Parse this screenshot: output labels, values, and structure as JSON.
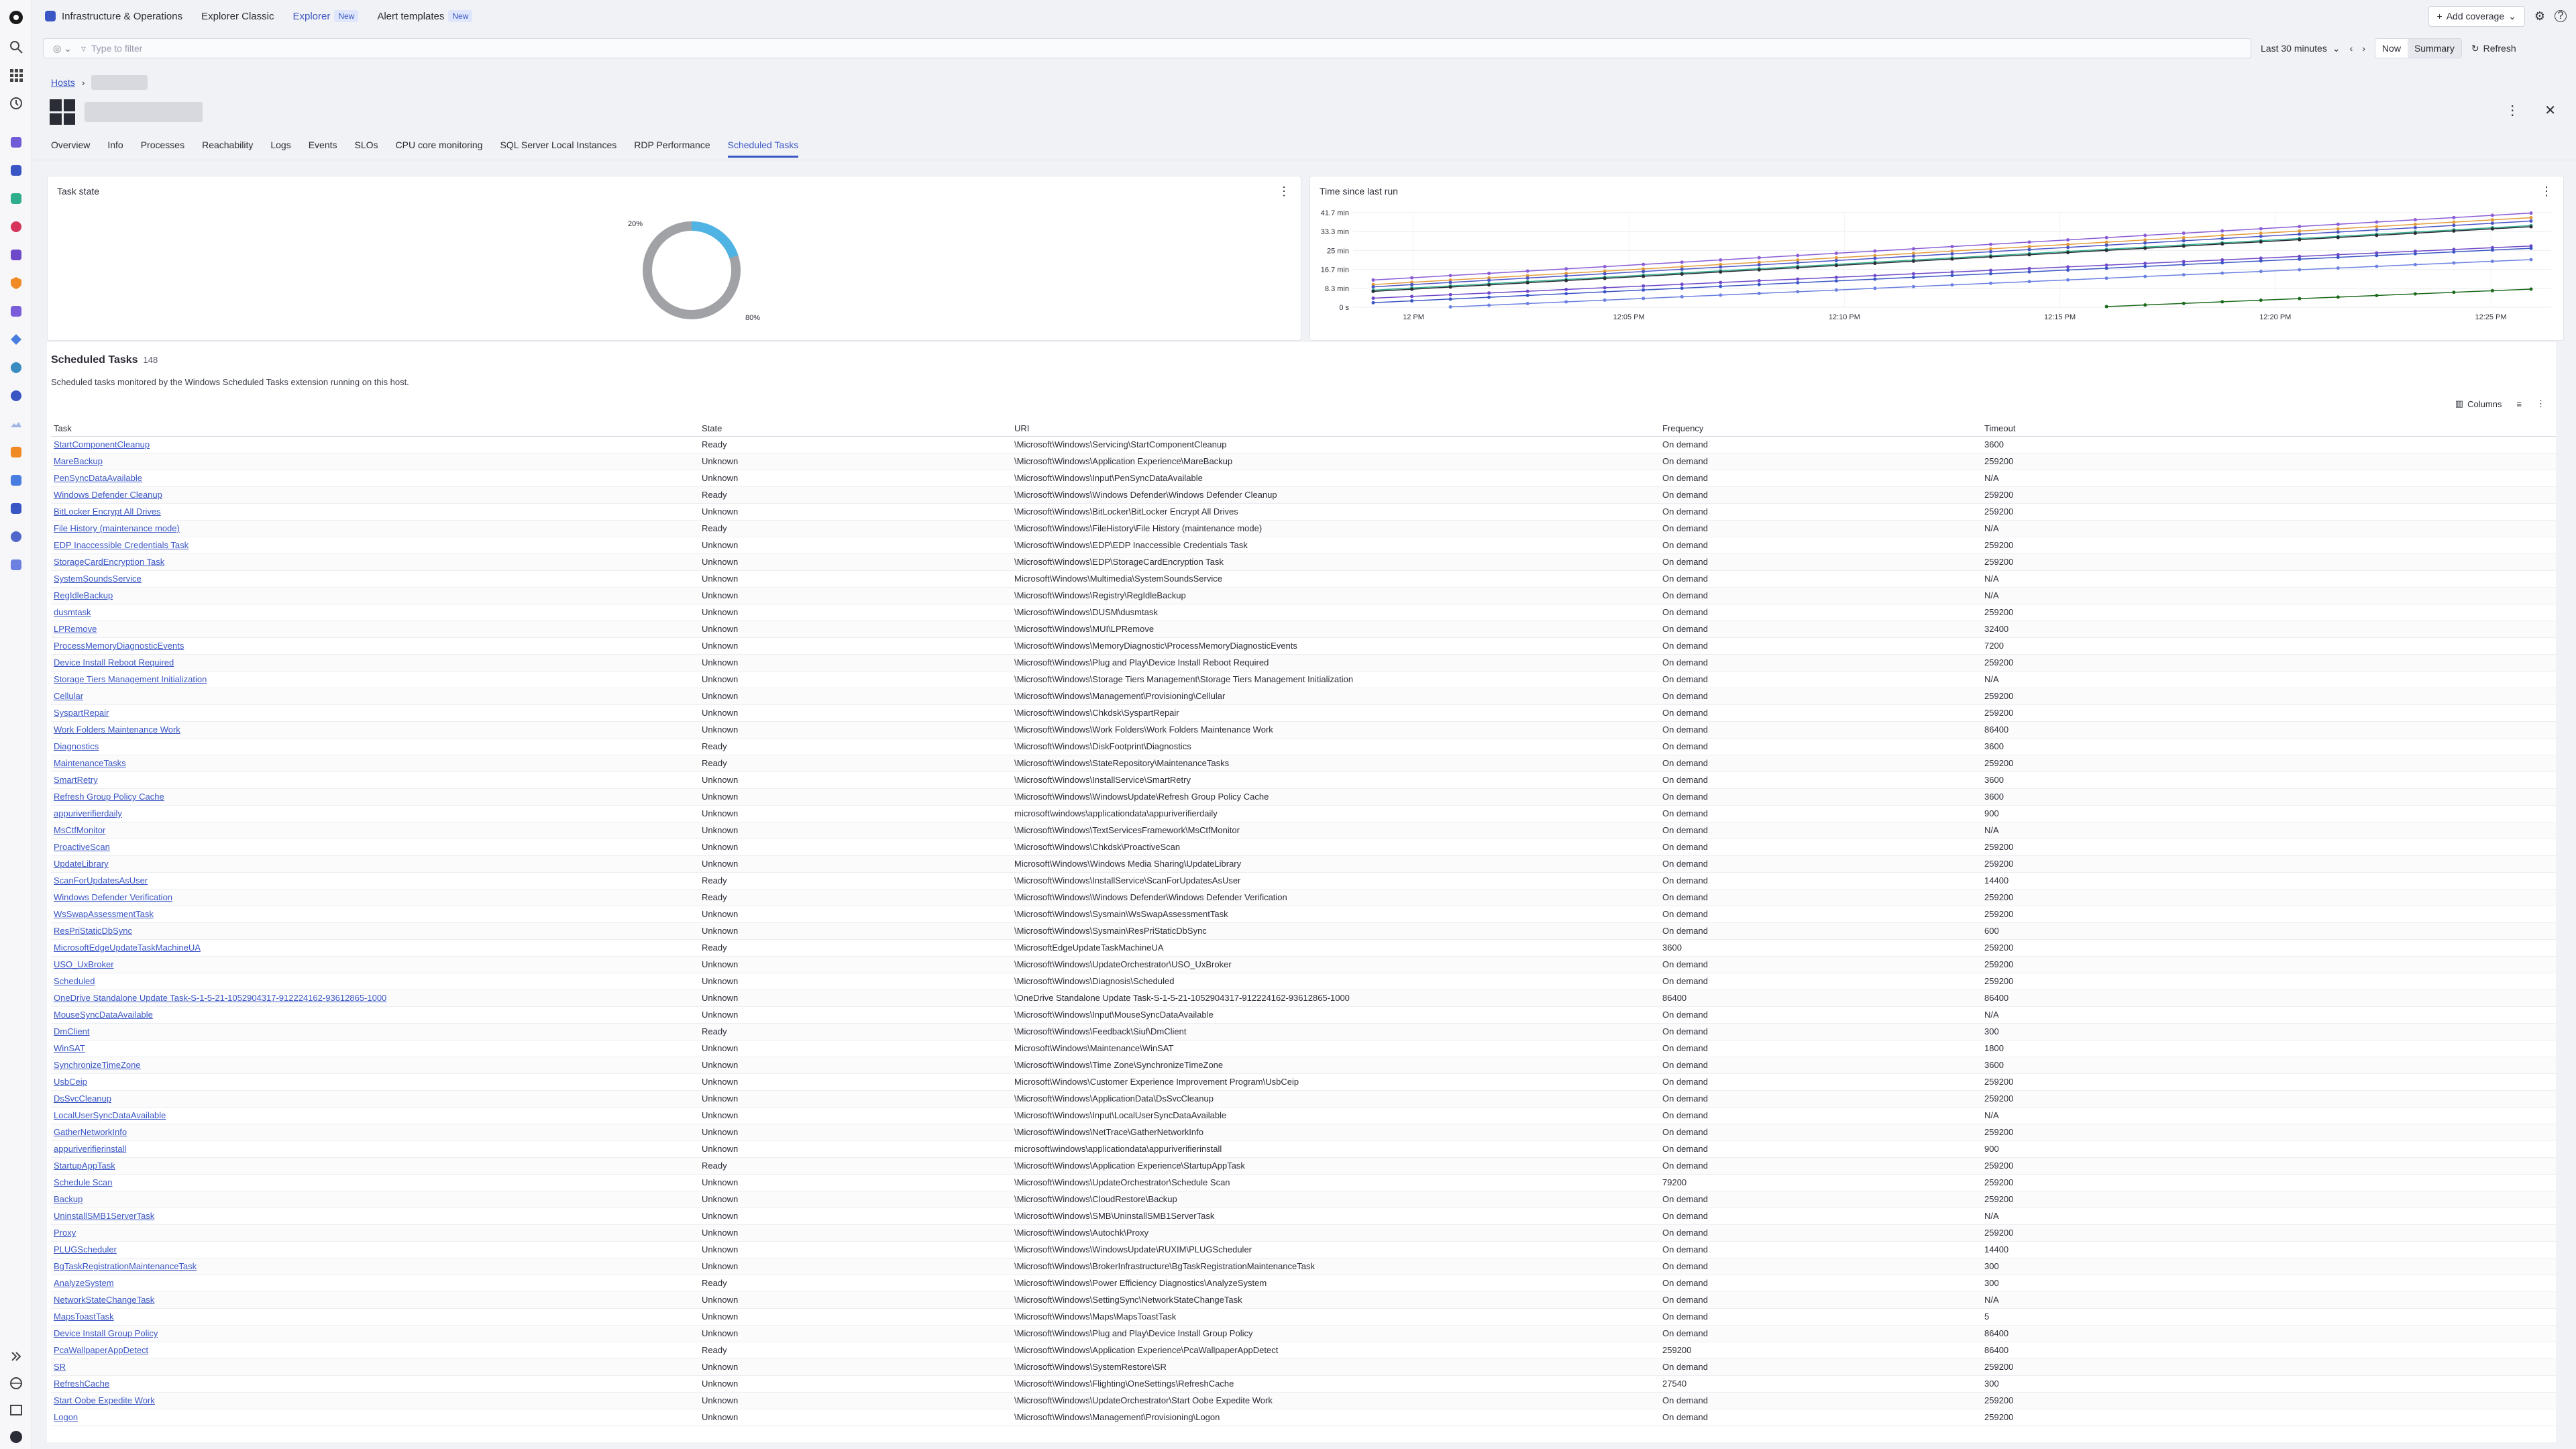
{
  "topbar": {
    "app_name": "Infrastructure & Operations",
    "tabs": [
      {
        "label": "Explorer Classic",
        "badge": ""
      },
      {
        "label": "Explorer",
        "badge": "New"
      },
      {
        "label": "Alert templates",
        "badge": "New"
      }
    ],
    "add_coverage": "Add coverage"
  },
  "filter": {
    "placeholder": "Type to filter",
    "timeframe": "Last 30 minutes",
    "now": "Now",
    "summary": "Summary",
    "refresh": "Refresh"
  },
  "breadcrumb": {
    "root": "Hosts"
  },
  "tabs": [
    "Overview",
    "Info",
    "Processes",
    "Reachability",
    "Logs",
    "Events",
    "SLOs",
    "CPU core monitoring",
    "SQL Server Local Instances",
    "RDP Performance",
    "Scheduled Tasks"
  ],
  "active_tab": "Scheduled Tasks",
  "task_state": {
    "title": "Task state",
    "label_small": "20%",
    "label_large": "80%"
  },
  "chart_data": {
    "type": "line",
    "title": "Time since last run",
    "y_ticks": [
      "0 s",
      "8.3 min",
      "16.7 min",
      "25 min",
      "33.3 min",
      "41.7 min"
    ],
    "x_ticks": [
      "12 PM",
      "12:05 PM",
      "12:10 PM",
      "12:15 PM",
      "12:20 PM",
      "12:25 PM"
    ],
    "ylim_min": [
      0,
      41.7
    ],
    "series": [
      {
        "color": "#8a5cd6",
        "values_min": [
          12,
          41.5
        ]
      },
      {
        "color": "#e39b3a",
        "values_min": [
          10,
          39.5
        ]
      },
      {
        "color": "#4a55c8",
        "values_min": [
          9,
          38
        ]
      },
      {
        "color": "#2fae8e",
        "values_min": [
          7.5,
          36
        ]
      },
      {
        "color": "#2b2d36",
        "values_min": [
          7,
          35.5
        ]
      },
      {
        "color": "#6e49c9",
        "values_min": [
          4,
          27
        ]
      },
      {
        "color": "#3a56c5",
        "values_min": [
          2,
          26
        ]
      },
      {
        "color": "#6b80e0",
        "values_min": [
          0,
          21
        ]
      },
      {
        "color": "#1d6b1d",
        "values_min": [
          0,
          8
        ]
      }
    ]
  },
  "section": {
    "title": "Scheduled Tasks",
    "count": "148",
    "description": "Scheduled tasks monitored by the Windows Scheduled Tasks extension running on this host.",
    "columns_btn": "Columns"
  },
  "table": {
    "headers": [
      "Task",
      "State",
      "URI",
      "Frequency",
      "Timeout"
    ],
    "rows": [
      [
        "StartComponentCleanup",
        "Ready",
        "\\Microsoft\\Windows\\Servicing\\StartComponentCleanup",
        "On demand",
        "3600"
      ],
      [
        "MareBackup",
        "Unknown",
        "\\Microsoft\\Windows\\Application Experience\\MareBackup",
        "On demand",
        "259200"
      ],
      [
        "PenSyncDataAvailable",
        "Unknown",
        "\\Microsoft\\Windows\\Input\\PenSyncDataAvailable",
        "On demand",
        "N/A"
      ],
      [
        "Windows Defender Cleanup",
        "Ready",
        "\\Microsoft\\Windows\\Windows Defender\\Windows Defender Cleanup",
        "On demand",
        "259200"
      ],
      [
        "BitLocker Encrypt All Drives",
        "Unknown",
        "\\Microsoft\\Windows\\BitLocker\\BitLocker Encrypt All Drives",
        "On demand",
        "259200"
      ],
      [
        "File History (maintenance mode)",
        "Ready",
        "\\Microsoft\\Windows\\FileHistory\\File History (maintenance mode)",
        "On demand",
        "N/A"
      ],
      [
        "EDP Inaccessible Credentials Task",
        "Unknown",
        "\\Microsoft\\Windows\\EDP\\EDP Inaccessible Credentials Task",
        "On demand",
        "259200"
      ],
      [
        "StorageCardEncryption Task",
        "Unknown",
        "\\Microsoft\\Windows\\EDP\\StorageCardEncryption Task",
        "On demand",
        "259200"
      ],
      [
        "SystemSoundsService",
        "Unknown",
        "Microsoft\\Windows\\Multimedia\\SystemSoundsService",
        "On demand",
        "N/A"
      ],
      [
        "RegIdleBackup",
        "Unknown",
        "\\Microsoft\\Windows\\Registry\\RegIdleBackup",
        "On demand",
        "N/A"
      ],
      [
        "dusmtask",
        "Unknown",
        "\\Microsoft\\Windows\\DUSM\\dusmtask",
        "On demand",
        "259200"
      ],
      [
        "LPRemove",
        "Unknown",
        "\\Microsoft\\Windows\\MUI\\LPRemove",
        "On demand",
        "32400"
      ],
      [
        "ProcessMemoryDiagnosticEvents",
        "Unknown",
        "\\Microsoft\\Windows\\MemoryDiagnostic\\ProcessMemoryDiagnosticEvents",
        "On demand",
        "7200"
      ],
      [
        "Device Install Reboot Required",
        "Unknown",
        "\\Microsoft\\Windows\\Plug and Play\\Device Install Reboot Required",
        "On demand",
        "259200"
      ],
      [
        "Storage Tiers Management Initialization",
        "Unknown",
        "\\Microsoft\\Windows\\Storage Tiers Management\\Storage Tiers Management Initialization",
        "On demand",
        "N/A"
      ],
      [
        "Cellular",
        "Unknown",
        "\\Microsoft\\Windows\\Management\\Provisioning\\Cellular",
        "On demand",
        "259200"
      ],
      [
        "SyspartRepair",
        "Unknown",
        "\\Microsoft\\Windows\\Chkdsk\\SyspartRepair",
        "On demand",
        "259200"
      ],
      [
        "Work Folders Maintenance Work",
        "Unknown",
        "\\Microsoft\\Windows\\Work Folders\\Work Folders Maintenance Work",
        "On demand",
        "86400"
      ],
      [
        "Diagnostics",
        "Ready",
        "\\Microsoft\\Windows\\DiskFootprint\\Diagnostics",
        "On demand",
        "3600"
      ],
      [
        "MaintenanceTasks",
        "Ready",
        "\\Microsoft\\Windows\\StateRepository\\MaintenanceTasks",
        "On demand",
        "259200"
      ],
      [
        "SmartRetry",
        "Unknown",
        "\\Microsoft\\Windows\\InstallService\\SmartRetry",
        "On demand",
        "3600"
      ],
      [
        "Refresh Group Policy Cache",
        "Unknown",
        "\\Microsoft\\Windows\\WindowsUpdate\\Refresh Group Policy Cache",
        "On demand",
        "3600"
      ],
      [
        "appuriverifierdaily",
        "Unknown",
        "microsoft\\windows\\applicationdata\\appuriverifierdaily",
        "On demand",
        "900"
      ],
      [
        "MsCtfMonitor",
        "Unknown",
        "\\Microsoft\\Windows\\TextServicesFramework\\MsCtfMonitor",
        "On demand",
        "N/A"
      ],
      [
        "ProactiveScan",
        "Unknown",
        "\\Microsoft\\Windows\\Chkdsk\\ProactiveScan",
        "On demand",
        "259200"
      ],
      [
        "UpdateLibrary",
        "Unknown",
        "Microsoft\\Windows\\Windows Media Sharing\\UpdateLibrary",
        "On demand",
        "259200"
      ],
      [
        "ScanForUpdatesAsUser",
        "Ready",
        "\\Microsoft\\Windows\\InstallService\\ScanForUpdatesAsUser",
        "On demand",
        "14400"
      ],
      [
        "Windows Defender Verification",
        "Ready",
        "\\Microsoft\\Windows\\Windows Defender\\Windows Defender Verification",
        "On demand",
        "259200"
      ],
      [
        "WsSwapAssessmentTask",
        "Unknown",
        "\\Microsoft\\Windows\\Sysmain\\WsSwapAssessmentTask",
        "On demand",
        "259200"
      ],
      [
        "ResPriStaticDbSync",
        "Unknown",
        "\\Microsoft\\Windows\\Sysmain\\ResPriStaticDbSync",
        "On demand",
        "600"
      ],
      [
        "MicrosoftEdgeUpdateTaskMachineUA",
        "Ready",
        "\\MicrosoftEdgeUpdateTaskMachineUA",
        "3600",
        "259200"
      ],
      [
        "USO_UxBroker",
        "Unknown",
        "\\Microsoft\\Windows\\UpdateOrchestrator\\USO_UxBroker",
        "On demand",
        "259200"
      ],
      [
        "Scheduled",
        "Unknown",
        "\\Microsoft\\Windows\\Diagnosis\\Scheduled",
        "On demand",
        "259200"
      ],
      [
        "OneDrive Standalone Update Task-S-1-5-21-1052904317-912224162-93612865-1000",
        "Unknown",
        "\\OneDrive Standalone Update Task-S-1-5-21-1052904317-912224162-93612865-1000",
        "86400",
        "86400"
      ],
      [
        "MouseSyncDataAvailable",
        "Unknown",
        "\\Microsoft\\Windows\\Input\\MouseSyncDataAvailable",
        "On demand",
        "N/A"
      ],
      [
        "DmClient",
        "Ready",
        "\\Microsoft\\Windows\\Feedback\\Siuf\\DmClient",
        "On demand",
        "300"
      ],
      [
        "WinSAT",
        "Unknown",
        "Microsoft\\Windows\\Maintenance\\WinSAT",
        "On demand",
        "1800"
      ],
      [
        "SynchronizeTimeZone",
        "Unknown",
        "\\Microsoft\\Windows\\Time Zone\\SynchronizeTimeZone",
        "On demand",
        "3600"
      ],
      [
        "UsbCeip",
        "Unknown",
        "Microsoft\\Windows\\Customer Experience Improvement Program\\UsbCeip",
        "On demand",
        "259200"
      ],
      [
        "DsSvcCleanup",
        "Unknown",
        "\\Microsoft\\Windows\\ApplicationData\\DsSvcCleanup",
        "On demand",
        "259200"
      ],
      [
        "LocalUserSyncDataAvailable",
        "Unknown",
        "\\Microsoft\\Windows\\Input\\LocalUserSyncDataAvailable",
        "On demand",
        "N/A"
      ],
      [
        "GatherNetworkInfo",
        "Unknown",
        "\\Microsoft\\Windows\\NetTrace\\GatherNetworkInfo",
        "On demand",
        "259200"
      ],
      [
        "appuriverifierinstall",
        "Unknown",
        "microsoft\\windows\\applicationdata\\appuriverifierinstall",
        "On demand",
        "900"
      ],
      [
        "StartupAppTask",
        "Ready",
        "\\Microsoft\\Windows\\Application Experience\\StartupAppTask",
        "On demand",
        "259200"
      ],
      [
        "Schedule Scan",
        "Unknown",
        "\\Microsoft\\Windows\\UpdateOrchestrator\\Schedule Scan",
        "79200",
        "259200"
      ],
      [
        "Backup",
        "Unknown",
        "\\Microsoft\\Windows\\CloudRestore\\Backup",
        "On demand",
        "259200"
      ],
      [
        "UninstallSMB1ServerTask",
        "Unknown",
        "\\Microsoft\\Windows\\SMB\\UninstallSMB1ServerTask",
        "On demand",
        "N/A"
      ],
      [
        "Proxy",
        "Unknown",
        "\\Microsoft\\Windows\\Autochk\\Proxy",
        "On demand",
        "259200"
      ],
      [
        "PLUGScheduler",
        "Unknown",
        "\\Microsoft\\Windows\\WindowsUpdate\\RUXIM\\PLUGScheduler",
        "On demand",
        "14400"
      ],
      [
        "BgTaskRegistrationMaintenanceTask",
        "Unknown",
        "\\Microsoft\\Windows\\BrokerInfrastructure\\BgTaskRegistrationMaintenanceTask",
        "On demand",
        "300"
      ],
      [
        "AnalyzeSystem",
        "Ready",
        "\\Microsoft\\Windows\\Power Efficiency Diagnostics\\AnalyzeSystem",
        "On demand",
        "300"
      ],
      [
        "NetworkStateChangeTask",
        "Unknown",
        "\\Microsoft\\Windows\\SettingSync\\NetworkStateChangeTask",
        "On demand",
        "N/A"
      ],
      [
        "MapsToastTask",
        "Unknown",
        "\\Microsoft\\Windows\\Maps\\MapsToastTask",
        "On demand",
        "5"
      ],
      [
        "Device Install Group Policy",
        "Unknown",
        "\\Microsoft\\Windows\\Plug and Play\\Device Install Group Policy",
        "On demand",
        "86400"
      ],
      [
        "PcaWallpaperAppDetect",
        "Ready",
        "\\Microsoft\\Windows\\Application Experience\\PcaWallpaperAppDetect",
        "259200",
        "86400"
      ],
      [
        "SR",
        "Unknown",
        "\\Microsoft\\Windows\\SystemRestore\\SR",
        "On demand",
        "259200"
      ],
      [
        "RefreshCache",
        "Unknown",
        "\\Microsoft\\Windows\\Flighting\\OneSettings\\RefreshCache",
        "27540",
        "300"
      ],
      [
        "Start Oobe Expedite Work",
        "Unknown",
        "\\Microsoft\\Windows\\UpdateOrchestrator\\Start Oobe Expedite Work",
        "On demand",
        "259200"
      ],
      [
        "Logon",
        "Unknown",
        "\\Microsoft\\Windows\\Management\\Provisioning\\Logon",
        "On demand",
        "259200"
      ]
    ]
  },
  "colors": {
    "accent": "#3a56c5",
    "donut_ready": "#4fb4e4",
    "donut_unknown": "#a1a2a6"
  }
}
